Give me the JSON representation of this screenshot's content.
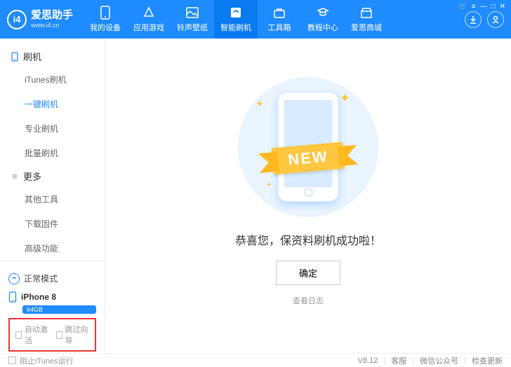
{
  "header": {
    "logo_text": "爱思助手",
    "logo_sub": "www.i4.cn",
    "logo_badge": "i4",
    "nav": [
      {
        "label": "我的设备"
      },
      {
        "label": "应用游戏"
      },
      {
        "label": "铃声壁纸"
      },
      {
        "label": "智能刷机",
        "active": true
      },
      {
        "label": "工具箱"
      },
      {
        "label": "教程中心"
      },
      {
        "label": "爱思商城"
      }
    ]
  },
  "sidebar": {
    "sections": [
      {
        "title": "刷机",
        "items": [
          "iTunes刷机",
          "一键刷机",
          "专业刷机",
          "批量刷机"
        ],
        "active_index": 1
      },
      {
        "title": "更多",
        "items": [
          "其他工具",
          "下载固件",
          "高级功能"
        ]
      }
    ],
    "mode": "正常模式",
    "device_name": "iPhone 8",
    "device_storage": "64GB",
    "checkboxes": [
      "自动激活",
      "跳过向导"
    ]
  },
  "main": {
    "ribbon": "NEW",
    "success_text": "恭喜您，保资料刷机成功啦！",
    "confirm": "确定",
    "view_log": "查看日志"
  },
  "footer": {
    "block_itunes": "阻止iTunes运行",
    "version": "V8.12",
    "links": [
      "客服",
      "微信公众号",
      "检查更新"
    ]
  }
}
